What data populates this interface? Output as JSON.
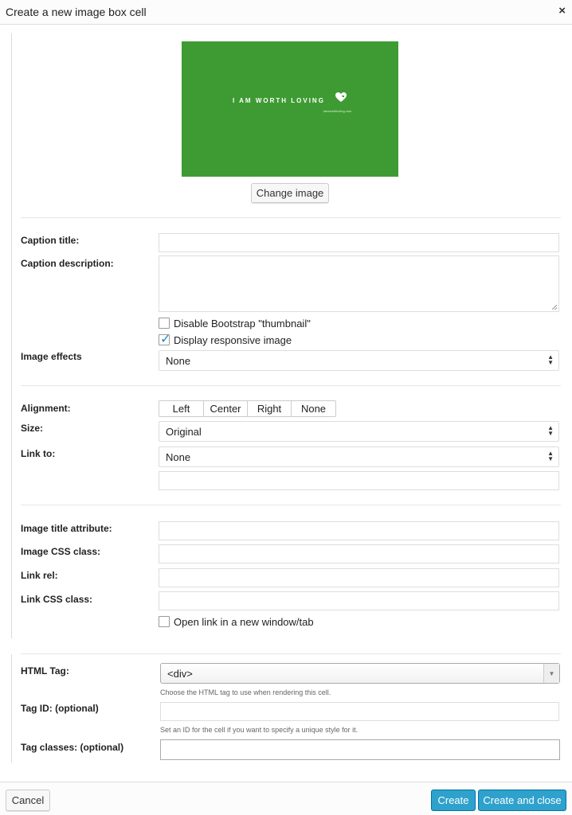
{
  "dialog": {
    "title": "Create a new image box cell",
    "close_icon": "×"
  },
  "image_preview": {
    "headline": "I AM WORTH LOVING",
    "subtext": "iamworthloving.com",
    "background_color": "#3e9b33",
    "change_image_label": "Change image"
  },
  "caption": {
    "title_label": "Caption title:",
    "title_value": "",
    "description_label": "Caption description:",
    "description_value": ""
  },
  "checkboxes": {
    "disable_thumbnail": {
      "label": "Disable Bootstrap \"thumbnail\"",
      "checked": false
    },
    "responsive_image": {
      "label": "Display responsive image",
      "checked": true
    }
  },
  "image_effects": {
    "label": "Image effects",
    "value": "None"
  },
  "alignment": {
    "label": "Alignment:",
    "options": [
      "Left",
      "Center",
      "Right",
      "None"
    ]
  },
  "size": {
    "label": "Size:",
    "value": "Original"
  },
  "link_to": {
    "label": "Link to:",
    "value": "None",
    "url_value": ""
  },
  "attributes": {
    "image_title_label": "Image title attribute:",
    "image_css_label": "Image CSS class:",
    "link_rel_label": "Link rel:",
    "link_css_label": "Link CSS class:",
    "new_window": {
      "label": "Open link in a new window/tab",
      "checked": false
    }
  },
  "cell_settings": {
    "html_tag_label": "HTML Tag:",
    "html_tag_value": "<div>",
    "html_tag_help": "Choose the HTML tag to use when rendering this cell.",
    "tag_id_label": "Tag ID: (optional)",
    "tag_id_help": "Set an ID for the cell if you want to specify a unique style for it.",
    "tag_classes_label": "Tag classes: (optional)"
  },
  "footer": {
    "cancel_label": "Cancel",
    "create_label": "Create",
    "create_close_label": "Create and close",
    "primary_color": "#2ea2cc"
  }
}
